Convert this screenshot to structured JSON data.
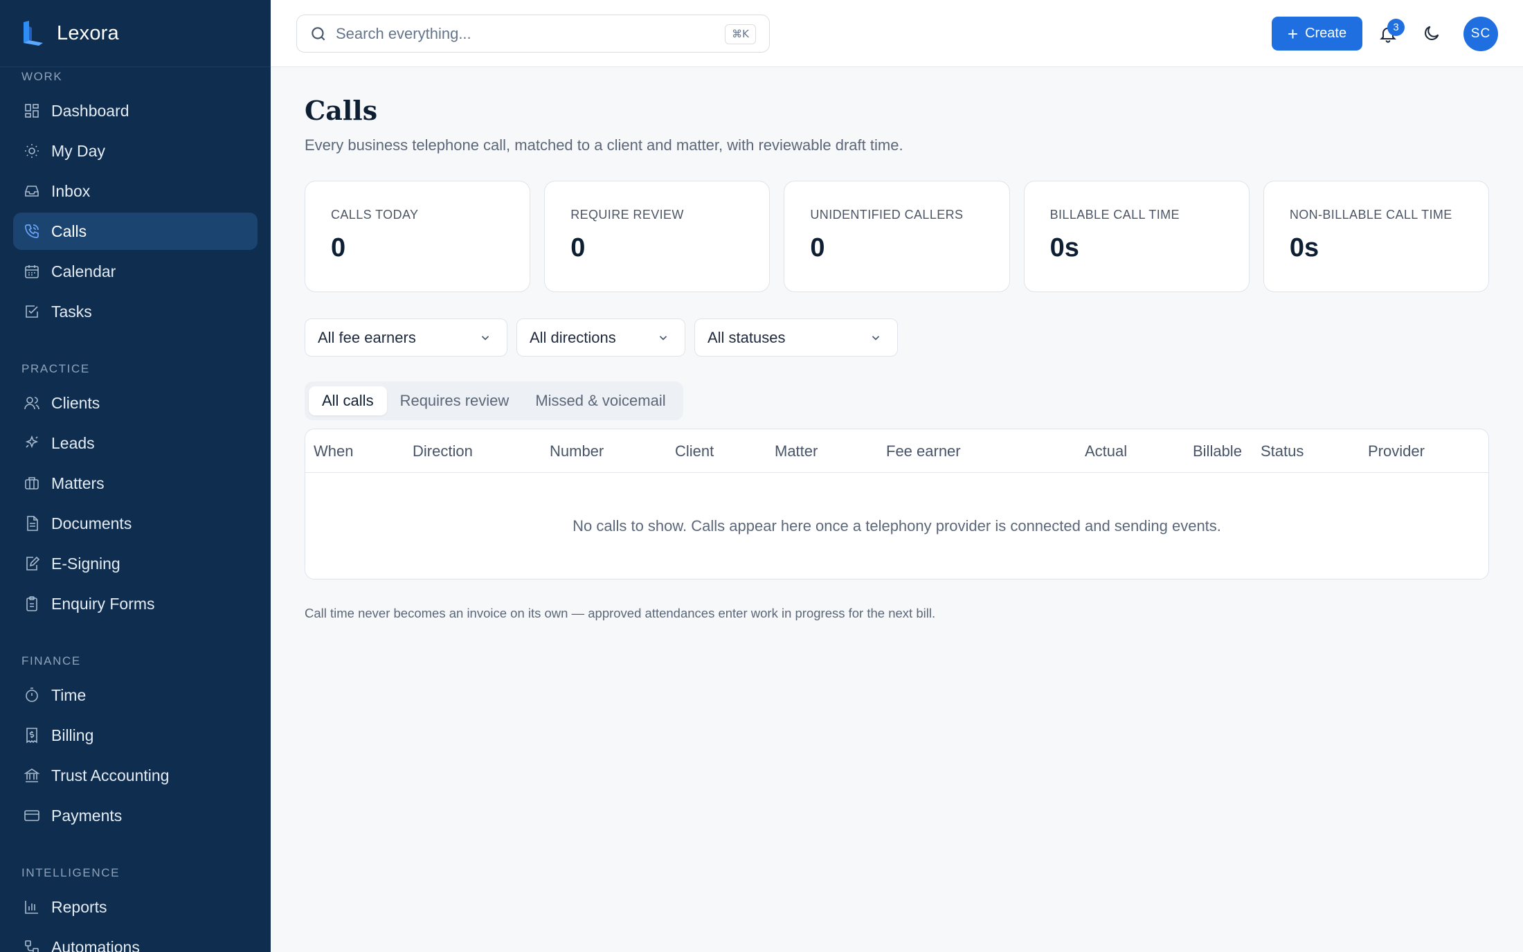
{
  "app": {
    "name": "Lexora"
  },
  "sidebar": {
    "sections": [
      {
        "label": "WORK",
        "items": [
          {
            "label": "Dashboard",
            "icon": "dashboard-icon"
          },
          {
            "label": "My Day",
            "icon": "sun-icon"
          },
          {
            "label": "Inbox",
            "icon": "inbox-icon"
          },
          {
            "label": "Calls",
            "icon": "phone-icon",
            "active": true
          },
          {
            "label": "Calendar",
            "icon": "calendar-icon"
          },
          {
            "label": "Tasks",
            "icon": "check-square-icon"
          }
        ]
      },
      {
        "label": "PRACTICE",
        "items": [
          {
            "label": "Clients",
            "icon": "users-icon"
          },
          {
            "label": "Leads",
            "icon": "sparkle-icon"
          },
          {
            "label": "Matters",
            "icon": "briefcase-icon"
          },
          {
            "label": "Documents",
            "icon": "document-icon"
          },
          {
            "label": "E-Signing",
            "icon": "signature-icon"
          },
          {
            "label": "Enquiry Forms",
            "icon": "clipboard-icon"
          }
        ]
      },
      {
        "label": "FINANCE",
        "items": [
          {
            "label": "Time",
            "icon": "stopwatch-icon"
          },
          {
            "label": "Billing",
            "icon": "receipt-icon"
          },
          {
            "label": "Trust Accounting",
            "icon": "bank-icon"
          },
          {
            "label": "Payments",
            "icon": "card-icon"
          }
        ]
      },
      {
        "label": "INTELLIGENCE",
        "items": [
          {
            "label": "Reports",
            "icon": "bar-chart-icon"
          },
          {
            "label": "Automations",
            "icon": "workflow-icon"
          }
        ]
      }
    ]
  },
  "topbar": {
    "search_placeholder": "Search everything...",
    "shortcut": "⌘K",
    "create_label": "Create",
    "notification_count": "3",
    "avatar_initials": "SC"
  },
  "page": {
    "title": "Calls",
    "subtitle": "Every business telephone call, matched to a client and matter, with reviewable draft time.",
    "stats": [
      {
        "label": "CALLS TODAY",
        "value": "0"
      },
      {
        "label": "REQUIRE REVIEW",
        "value": "0"
      },
      {
        "label": "UNIDENTIFIED CALLERS",
        "value": "0"
      },
      {
        "label": "BILLABLE CALL TIME",
        "value": "0s"
      },
      {
        "label": "NON-BILLABLE CALL TIME",
        "value": "0s"
      }
    ],
    "filters": [
      "All fee earners",
      "All directions",
      "All statuses"
    ],
    "tabs": [
      {
        "label": "All calls",
        "active": true
      },
      {
        "label": "Requires review"
      },
      {
        "label": "Missed & voicemail"
      }
    ],
    "table": {
      "columns": [
        "When",
        "Direction",
        "Number",
        "Client",
        "Matter",
        "Fee earner",
        "Actual",
        "Billable",
        "Status",
        "Provider"
      ],
      "empty_message": "No calls to show. Calls appear here once a telephony provider is connected and sending events."
    },
    "footnote": "Call time never becomes an invoice on its own — approved attendances enter work in progress for the next bill."
  },
  "colors": {
    "sidebar_bg": "#0f2d4f",
    "accent": "#1f6fe0",
    "page_bg": "#f7f8fa"
  }
}
